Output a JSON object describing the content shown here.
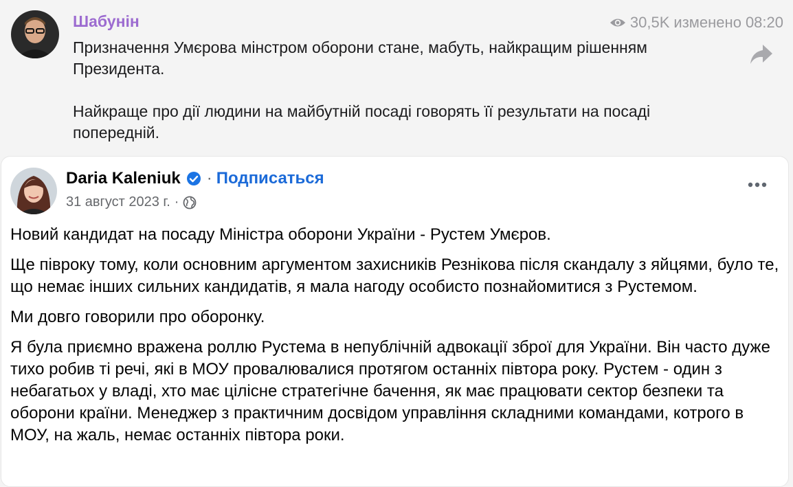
{
  "telegram": {
    "author": "Шабунін",
    "views": "30,5K",
    "edited_label": "изменено",
    "time": "08:20",
    "paragraphs": [
      "Призначення Умєрова мінстром оборони стане, мабуть, найкращим рішенням Президента.",
      "Найкраще про дії людини на майбутній посаді говорять її результати на посаді попередній."
    ],
    "icons": {
      "views": "eye-icon",
      "share": "share-arrow-icon"
    }
  },
  "facebook_post": {
    "author": "Daria Kaleniuk",
    "separator": "·",
    "follow_label": "Подписаться",
    "date": "31 август 2023 г.",
    "date_separator": "·",
    "icons": {
      "verified": "verified-badge-icon",
      "audience": "globe-icon",
      "more": "more-options-icon"
    },
    "accent_color": "#1b6ad8",
    "paragraphs": [
      "Новий кандидат на посаду Міністра оборони України - Рустем Умєров.",
      "Ще півроку тому, коли основним аргументом захисників Резнікова після скандалу з яйцями, було те, що немає інших сильних кандидатів, я мала нагоду особисто познайомитися з Рустемом.",
      "Ми довго говорили про оборонку.",
      "Я була приємно вражена роллю Рустема в непублічній адвокації зброї для України. Він часто дуже тихо робив ті речі, які в МОУ провалювалися протягом останніх півтора року. Рустем - один з небагатьох у владі, хто має цілісне стратегічне бачення, як має працювати сектор безпеки та оборони країни. Менеджер з практичним досвідом управління складними командами, котрого в МОУ, на жаль, немає останніх півтора роки."
    ]
  }
}
